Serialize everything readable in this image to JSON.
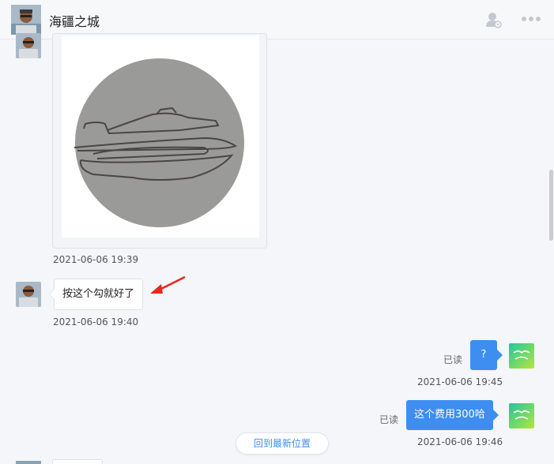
{
  "header": {
    "title": "海疆之城"
  },
  "messages": {
    "image_time": "2021-06-06 19:39",
    "text_in": "按这个勾就好了",
    "text_in_time": "2021-06-06 19:40",
    "out1_text": "?",
    "out1_status": "已读",
    "out1_time": "2021-06-06 19:45",
    "out2_text": "这个费用300哈",
    "out2_status": "已读",
    "out2_time": "2021-06-06 19:46"
  },
  "jump_button": "回到最新位置",
  "icons": {
    "user_settings": "user-settings-icon",
    "more": "more-icon",
    "annotation": "red-arrow-icon"
  },
  "colors": {
    "accent": "#3d8ef0",
    "annotation": "#e8261c"
  }
}
